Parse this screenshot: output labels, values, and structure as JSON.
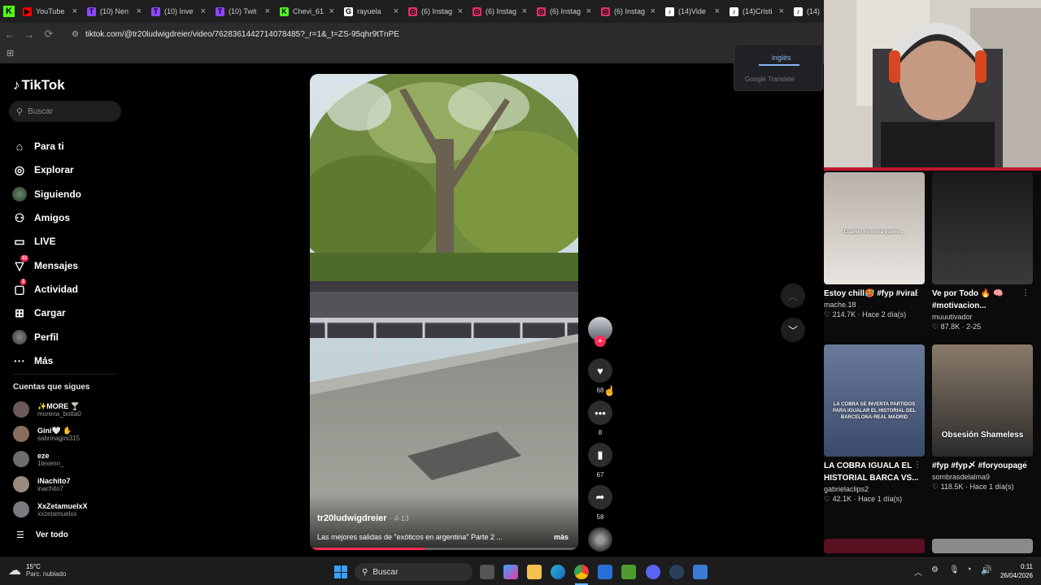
{
  "browser": {
    "tabs": [
      {
        "label": "YouTube",
        "color": "#ff0000",
        "glyph": "▶"
      },
      {
        "label": "(10) Nen",
        "color": "#9146ff",
        "glyph": "T"
      },
      {
        "label": "(10) Inve",
        "color": "#9146ff",
        "glyph": "T"
      },
      {
        "label": "(10) Twit",
        "color": "#9146ff",
        "glyph": "T"
      },
      {
        "label": "Chevi_61",
        "color": "#53fc18",
        "glyph": "K"
      },
      {
        "label": "rayuela",
        "color": "#ffffff",
        "glyph": "G"
      },
      {
        "label": "(6) Instag",
        "color": "#e1306c",
        "glyph": "◎"
      },
      {
        "label": "(6) Instag",
        "color": "#e1306c",
        "glyph": "◎"
      },
      {
        "label": "(6) Instag",
        "color": "#e1306c",
        "glyph": "◎"
      },
      {
        "label": "(6) Instag",
        "color": "#e1306c",
        "glyph": "◎"
      },
      {
        "label": "(14)Vide",
        "color": "#ffffff",
        "glyph": "♪"
      },
      {
        "label": "(14)Cristi",
        "color": "#ffffff",
        "glyph": "♪"
      },
      {
        "label": "(14)",
        "color": "#ffffff",
        "glyph": "♪"
      }
    ],
    "url": "tiktok.com/@tr20ludwigdreier/video/7628361442714078485?_r=1&_t=ZS-95qhr9tTnPE"
  },
  "translate_popup": {
    "language": "inglés",
    "provider": "Google Translate"
  },
  "sidebar": {
    "logo": "TikTok",
    "search_placeholder": "Buscar",
    "nav": [
      {
        "label": "Para ti",
        "icon": "home-icon"
      },
      {
        "label": "Explorar",
        "icon": "compass-icon"
      },
      {
        "label": "Siguiendo",
        "icon": "following-avatar-icon"
      },
      {
        "label": "Amigos",
        "icon": "friends-icon"
      },
      {
        "label": "LIVE",
        "icon": "live-icon"
      },
      {
        "label": "Mensajes",
        "icon": "messages-icon",
        "badge": "11"
      },
      {
        "label": "Actividad",
        "icon": "activity-icon",
        "badge": "3"
      },
      {
        "label": "Cargar",
        "icon": "upload-icon"
      },
      {
        "label": "Perfil",
        "icon": "profile-avatar-icon"
      },
      {
        "label": "Más",
        "icon": "more-icon"
      }
    ],
    "following_title": "Cuentas que sigues",
    "following": [
      {
        "name": "✨MORE 🍸",
        "handle": "morena_botta0"
      },
      {
        "name": "Gini🤍 ✋",
        "handle": "sabrinagini315"
      },
      {
        "name": "eze",
        "handle": "1lexenn_"
      },
      {
        "name": "iNachito7",
        "handle": "inachito7"
      },
      {
        "name": "XxZetamuelxX",
        "handle": "xxzetamuelxx"
      }
    ],
    "see_all": "Ver todo"
  },
  "video": {
    "author": "tr20ludwigdreier",
    "date": "4-13",
    "description": "Las mejores salidas de \"exóticos en argentina\" Parte 2 ...",
    "more_label": "más",
    "progress": 0.43,
    "actions": {
      "likes": "68",
      "comments": "8",
      "saves": "67",
      "shares": "58"
    }
  },
  "recommended": [
    {
      "caption": "Estoy chill🥵 #fyp #viral",
      "author": "mache.18",
      "likes": "214.7K",
      "ago": "Hace 2 día(s)",
      "overlay": "Cuando mi novia quiere ..."
    },
    {
      "caption": "Ve por Todo 🔥 🧠 #motivacion...",
      "author": "muuutivador",
      "likes": "87.8K",
      "ago": "2-25",
      "overlay": ""
    },
    {
      "caption": "LA COBRA IGUALA EL HISTORIAL BARCA VS...",
      "author": "gabrielaclips2",
      "likes": "42.1K",
      "ago": "Hace 1 día(s)",
      "overlay": "LA COBRA SE INVENTA PARTIDOS PARA IGUALAR EL HISTORIAL DEL BARCELONA-REAL MADRID"
    },
    {
      "caption": "#fyp #fyp〆 #foryoupage",
      "author": "sombrasdelalma9",
      "likes": "118.5K",
      "ago": "Hace 1 día(s)",
      "overlay": "Obsesión Shameless"
    }
  ],
  "taskbar": {
    "weather_temp": "15°C",
    "weather_desc": "Parc. nublado",
    "search_placeholder": "Buscar",
    "time": "0:11",
    "date": "26/04/2026"
  },
  "colors": {
    "accent": "#fe2c55",
    "background": "#000000",
    "bar": "#2b2b2b"
  }
}
